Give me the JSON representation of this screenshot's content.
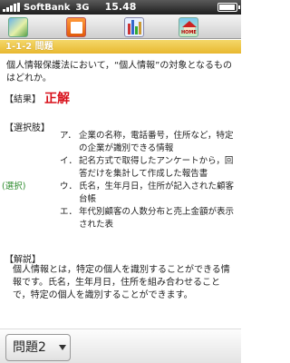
{
  "status_bar": {
    "carrier": "SoftBank",
    "network": "3G",
    "time": "15.48"
  },
  "toolbar": {
    "icons": [
      "landscape-icon",
      "book-icon",
      "chart-icon",
      "home-icon"
    ],
    "home_label": "HOME"
  },
  "header": {
    "title": "1-1-2 問題"
  },
  "question": "個人情報保護法において，“個人情報”の対象となるものはどれか。",
  "result": {
    "label": "【結果】",
    "answer": "正解",
    "answer_color": "#d8101a"
  },
  "choices_header": "【選択肢】",
  "choices": [
    {
      "mark": "",
      "letter": "ア．",
      "text": "企業の名称，電話番号，住所など，特定の企業が識別できる情報"
    },
    {
      "mark": "",
      "letter": "イ．",
      "text": "記名方式で取得したアンケートから，回答だけを集計して作成した報告書"
    },
    {
      "mark": "(選択)",
      "letter": "ウ．",
      "text": "氏名，生年月日，住所が記入された顧客台帳"
    },
    {
      "mark": "",
      "letter": "エ．",
      "text": "年代別顧客の人数分布と売上金額が表示された表"
    }
  ],
  "explanation_header": "【解説】",
  "explanation": "個人情報とは，特定の個人を識別することができる情報です。氏名，生年月日，住所を組み合わせることで，特定の個人を識別することができます。",
  "picker": {
    "value": "問題2"
  }
}
